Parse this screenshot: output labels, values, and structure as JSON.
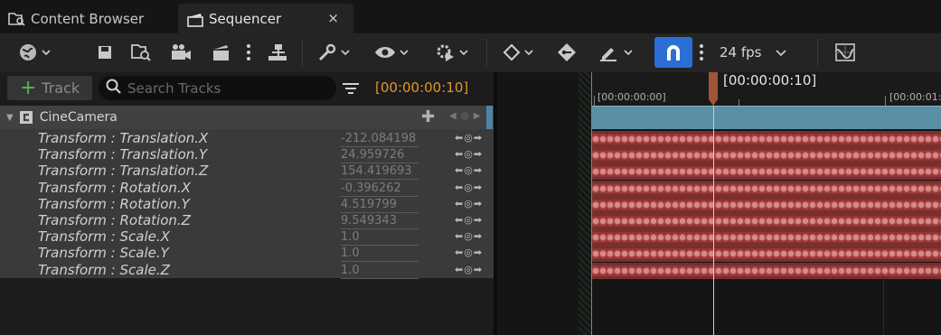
{
  "tabs": [
    {
      "label": "Content Browser"
    },
    {
      "label": "Sequencer",
      "close": "×"
    }
  ],
  "toolbar": {
    "fps": "24 fps"
  },
  "left_panel": {
    "add_track_label": "Track",
    "search_placeholder": "Search Tracks",
    "current_time": "[00:00:00:10]"
  },
  "tree": {
    "camera_name": "CineCamera",
    "properties": [
      {
        "name": "Transform : Translation.X",
        "value": "-212.084198"
      },
      {
        "name": "Transform : Translation.Y",
        "value": "24.959726"
      },
      {
        "name": "Transform : Translation.Z",
        "value": "154.419693"
      },
      {
        "name": "Transform : Rotation.X",
        "value": "-0.396262"
      },
      {
        "name": "Transform : Rotation.Y",
        "value": "4.519799"
      },
      {
        "name": "Transform : Rotation.Z",
        "value": "9.549343"
      },
      {
        "name": "Transform : Scale.X",
        "value": "1.0"
      },
      {
        "name": "Transform : Scale.Y",
        "value": "1.0"
      },
      {
        "name": "Transform : Scale.Z",
        "value": "1.0"
      }
    ]
  },
  "timeline": {
    "playhead_time": "[00:00:00:10]",
    "ruler_labels": [
      "[00:00:00:00]",
      "[00:00:01:"
    ]
  },
  "colors": {
    "accent_orange": "#e0962c",
    "snap_blue": "#2b6fd6",
    "camera_track": "#5b8fa3",
    "key_track": "#b24b4b",
    "start_green": "#3bb43b"
  }
}
